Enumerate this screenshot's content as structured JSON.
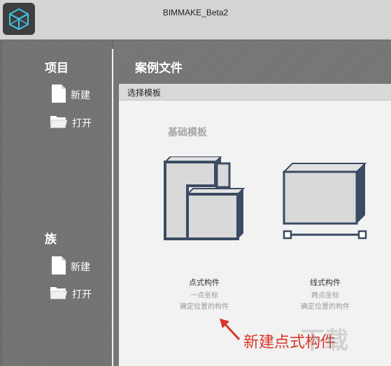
{
  "window": {
    "title": "BIMMAKE_Beta2",
    "logo_icon": "bimmake-cube-logo"
  },
  "sidebar": {
    "project": {
      "title": "项目",
      "items": [
        {
          "label": "新建",
          "icon": "new-file-icon"
        },
        {
          "label": "打开",
          "icon": "open-folder-icon"
        }
      ]
    },
    "family": {
      "title": "族",
      "items": [
        {
          "label": "新建",
          "icon": "new-file-icon"
        },
        {
          "label": "打开",
          "icon": "open-folder-icon"
        }
      ]
    }
  },
  "main": {
    "title": "案例文件",
    "panel": {
      "header": "选择模板",
      "section": "基础模板",
      "templates": [
        {
          "name": "点式构件",
          "desc_line1": "一点坐标",
          "desc_line2": "确定位置的构件"
        },
        {
          "name": "线式构件",
          "desc_line1": "两点坐标",
          "desc_line2": "确定位置的构件"
        }
      ]
    }
  },
  "annotation": {
    "text": "新建点式构件",
    "color": "#d8362a"
  },
  "watermark": {
    "text": "下载"
  }
}
